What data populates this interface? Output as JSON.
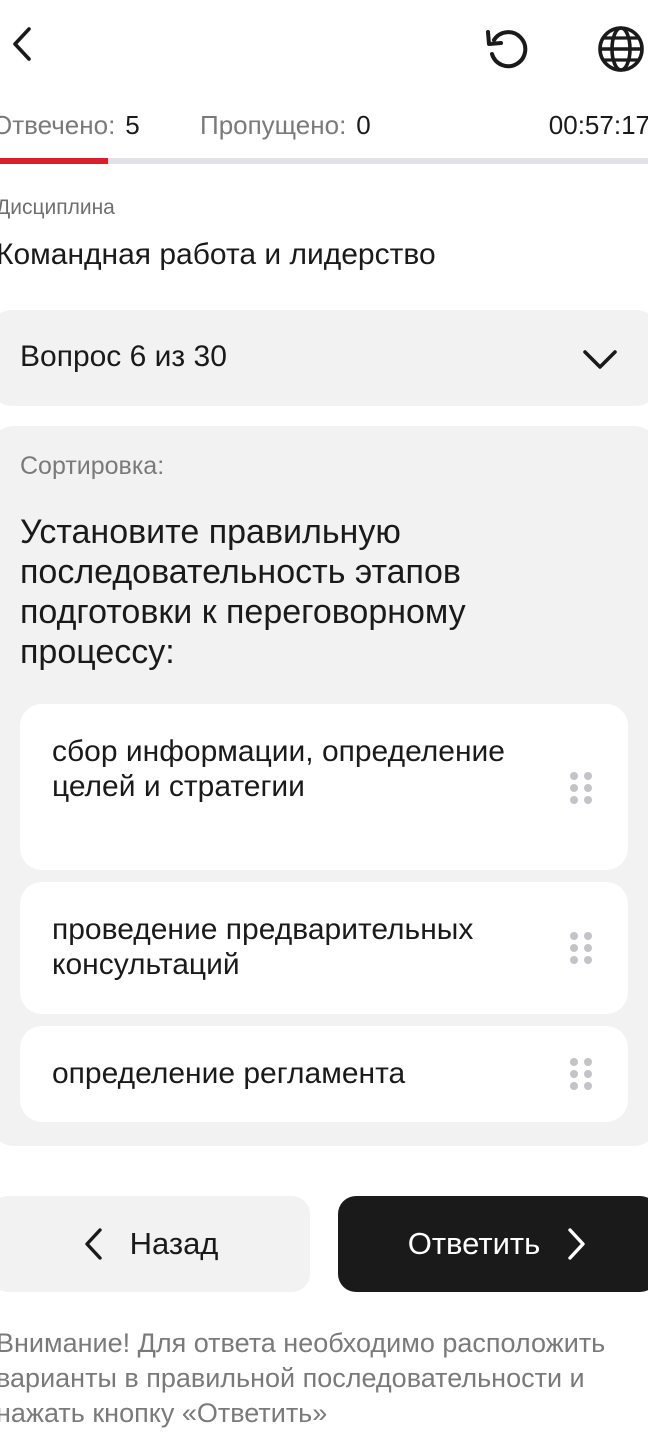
{
  "header": {
    "back_icon": "chevron-left-icon",
    "reset_icon": "reset-icon",
    "language_icon": "globe-icon"
  },
  "stats": {
    "answered_label": "Отвечено:",
    "answered_value": "5",
    "skipped_label": "Пропущено:",
    "skipped_value": "0",
    "timer": "00:57:17",
    "progress_fraction": 0.1667,
    "progress_color": "#d9202a"
  },
  "discipline": {
    "label": "Дисциплина",
    "value": "Командная работа и лидерство"
  },
  "question_selector": {
    "label": "Вопрос 6 из 30"
  },
  "question": {
    "type_label": "Сортировка:",
    "text": "Установите правильную последовательность этапов подготовки к переговорному процессу:",
    "options": [
      {
        "label": "сбор информации, определение целей и стратегии"
      },
      {
        "label": "проведение предварительных консультаций"
      },
      {
        "label": "определение регламента"
      }
    ]
  },
  "buttons": {
    "back_label": "Назад",
    "answer_label": "Ответить"
  },
  "notice": "Внимание! Для ответа необходимо расположить варианты в правильной последовательности и нажать кнопку «Ответить»"
}
